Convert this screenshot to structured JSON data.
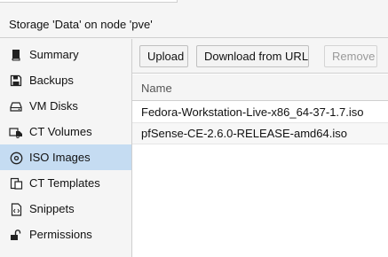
{
  "header": {
    "title": "Storage 'Data' on node 'pve'"
  },
  "sidebar": {
    "items": [
      {
        "label": "Summary",
        "icon": "book-icon",
        "active": false
      },
      {
        "label": "Backups",
        "icon": "floppy-disk-icon",
        "active": false
      },
      {
        "label": "VM Disks",
        "icon": "hard-drive-icon",
        "active": false
      },
      {
        "label": "CT Volumes",
        "icon": "container-icon",
        "active": false
      },
      {
        "label": "ISO Images",
        "icon": "disc-icon",
        "active": true
      },
      {
        "label": "CT Templates",
        "icon": "template-icon",
        "active": false
      },
      {
        "label": "Snippets",
        "icon": "code-file-icon",
        "active": false
      },
      {
        "label": "Permissions",
        "icon": "unlock-icon",
        "active": false
      }
    ]
  },
  "toolbar": {
    "upload_label": "Upload",
    "download_label": "Download from URL",
    "remove_label": "Remove"
  },
  "grid": {
    "columns": [
      "Name"
    ],
    "rows": [
      "Fedora-Workstation-Live-x86_64-37-1.7.iso",
      "pfSense-CE-2.6.0-RELEASE-amd64.iso"
    ]
  },
  "colors": {
    "active_nav": "#c5dcf2",
    "panel_bg": "#f5f5f5",
    "border": "#cfcfcf"
  }
}
